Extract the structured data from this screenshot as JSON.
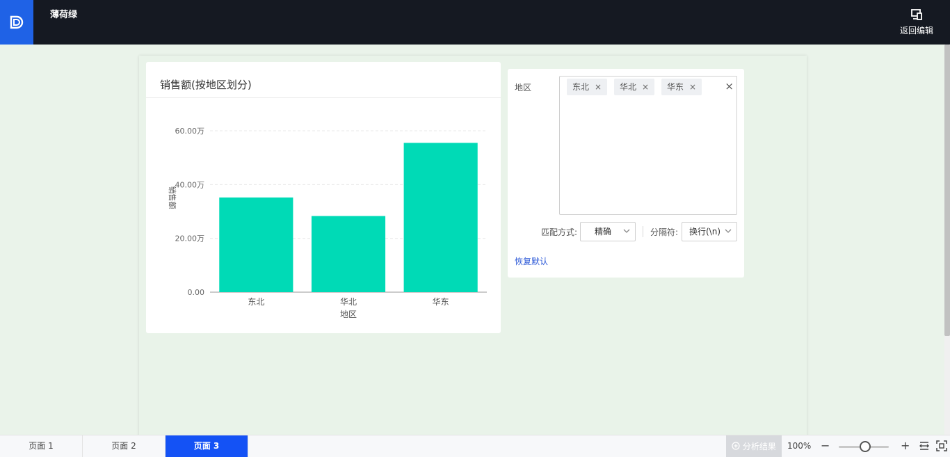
{
  "header": {
    "app_title": "薄荷绿",
    "back_edit_label": "返回编辑"
  },
  "chart_card": {
    "title": "销售额(按地区划分)"
  },
  "chart_data": {
    "type": "bar",
    "categories": [
      "东北",
      "华北",
      "华东"
    ],
    "values": [
      35.2,
      28.3,
      55.5
    ],
    "ylim": [
      0,
      60
    ],
    "yticks": [
      0,
      20,
      40,
      60
    ],
    "ytick_labels": [
      "0.00",
      "20.00万",
      "40.00万",
      "60.00万"
    ],
    "xlabel": "地区",
    "ylabel": "销售额",
    "grid": true,
    "bar_color": "#00dab6"
  },
  "filter": {
    "label": "地区",
    "tags": [
      "东北",
      "华北",
      "华东"
    ],
    "tag_close": "×",
    "clear_all": "×",
    "match_label": "匹配方式:",
    "match_value": "精确",
    "separator_label": "分隔符:",
    "separator_value": "换行(\\n)",
    "restore_label": "恢复默认"
  },
  "bottom": {
    "pages": [
      "页面 1",
      "页面 2",
      "页面 3"
    ],
    "active_page": 2,
    "analysis_label": "分析结果",
    "zoom": "100%",
    "zoom_minus": "−",
    "zoom_plus": "+"
  },
  "colors": {
    "topbar": "#151922",
    "brand": "#1f62e6",
    "active_tab": "#1452f5",
    "canvas": "#e9f3e9",
    "link": "#2f5bd8"
  }
}
